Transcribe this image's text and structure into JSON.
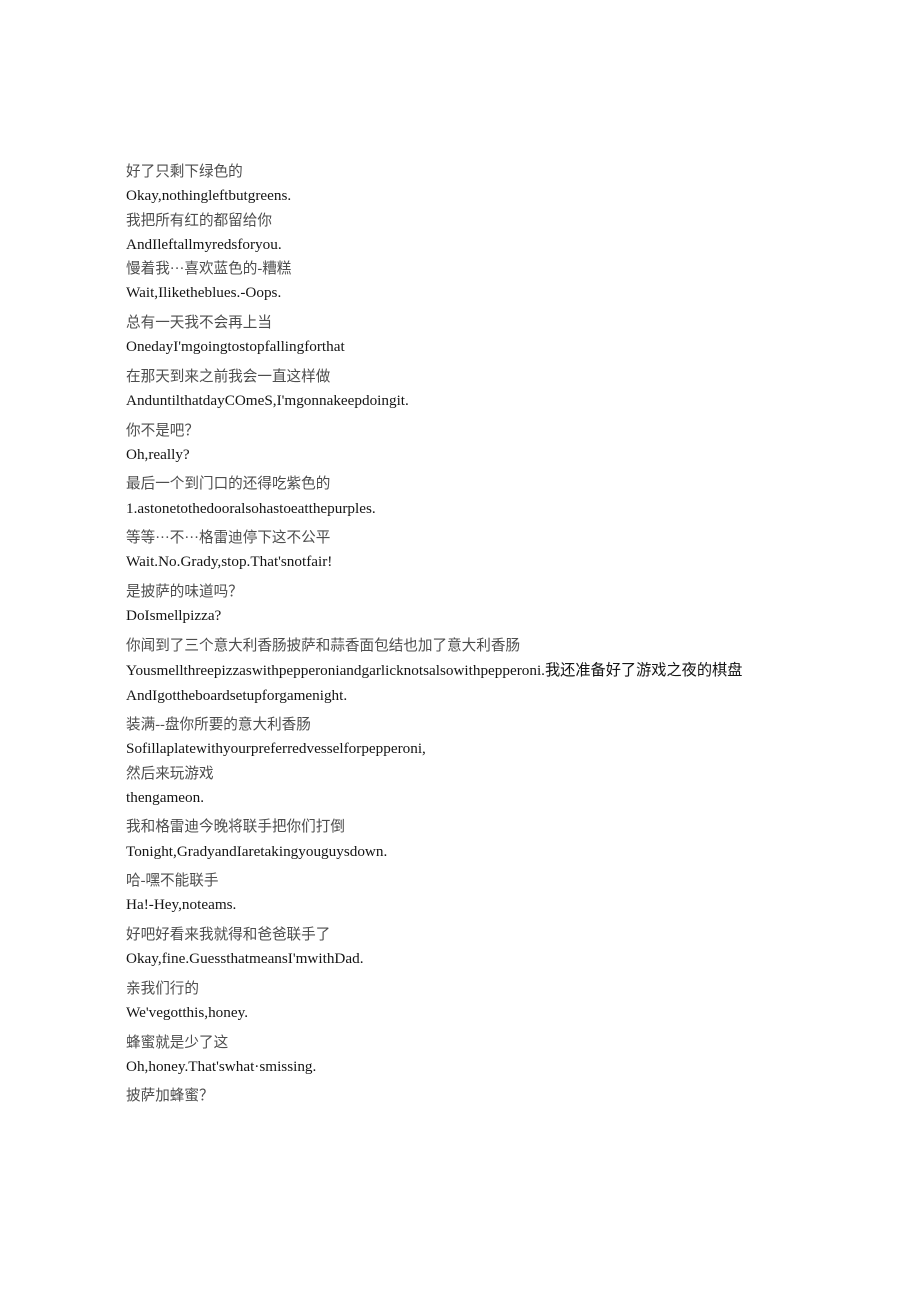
{
  "document": {
    "type": "bilingual-subtitle-transcript",
    "background_color": "#ffffff",
    "chinese_color": "#4d4d4d",
    "english_color": "#141414",
    "lines": [
      {
        "lang": "zh",
        "text": "好了只剩下绿色的",
        "spacing": "tight"
      },
      {
        "lang": "en",
        "text": "Okay,nothingleftbutgreens."
      },
      {
        "lang": "zh",
        "text": "我把所有红的都留给你",
        "spacing": "tight"
      },
      {
        "lang": "en",
        "text": "AndIleftallmyredsforyou."
      },
      {
        "lang": "zh",
        "text": "慢着我···喜欢蓝色的-糟糕",
        "spacing": "tight"
      },
      {
        "lang": "en",
        "text": "Wait,Iliketheblues.-Oops."
      },
      {
        "lang": "zh",
        "text": "总有一天我不会再上当",
        "spacing": "cue"
      },
      {
        "lang": "en",
        "text": "OnedayI'mgoingtostopfallingforthat"
      },
      {
        "lang": "zh",
        "text": "在那天到来之前我会一直这样做",
        "spacing": "cue"
      },
      {
        "lang": "en",
        "text": "AnduntilthatdayCOmeS,I'mgonnakeepdoingit."
      },
      {
        "lang": "zh",
        "text": "你不是吧？",
        "spacing": "cue"
      },
      {
        "lang": "en",
        "text": "Oh,really?"
      },
      {
        "lang": "zh",
        "text": "最后一个到门口的还得吃紫色的",
        "spacing": "cue"
      },
      {
        "lang": "en",
        "text": "1.astonetothedooralsohastoeatthepurples."
      },
      {
        "lang": "zh",
        "text": "等等···不···格雷迪停下这不公平",
        "spacing": "cue"
      },
      {
        "lang": "en",
        "text": "Wait.No.Grady,stop.That'snotfair!"
      },
      {
        "lang": "zh",
        "text": "是披萨的味道吗？",
        "spacing": "cue"
      },
      {
        "lang": "en",
        "text": "DoIsmellpizza?"
      },
      {
        "lang": "zh",
        "text": "你闻到了三个意大利香肠披萨和蒜香面包结也加了意大利香肠",
        "spacing": "cue"
      },
      {
        "lang": "en",
        "text": "Yousmellthreepizzaswithpepperoniandgarlicknotsalsowithpepperoni.我还准备好了游戏之夜的棋盘",
        "wrap": true
      },
      {
        "lang": "en",
        "text": "AndIgottheboardsetupforgamenight."
      },
      {
        "lang": "zh",
        "text": "装满--盘你所要的意大利香肠",
        "spacing": "cue"
      },
      {
        "lang": "en",
        "text": "Sofillaplatewithyourpreferredvesselforpepperoni,"
      },
      {
        "lang": "zh",
        "text": "然后来玩游戏",
        "spacing": "tight"
      },
      {
        "lang": "en",
        "text": "thengameon."
      },
      {
        "lang": "zh",
        "text": "我和格雷迪今晚将联手把你们打倒",
        "spacing": "cue"
      },
      {
        "lang": "en",
        "text": "Tonight,GradyandIaretakingyouguysdown."
      },
      {
        "lang": "zh",
        "text": "哈-嘿不能联手",
        "spacing": "cue"
      },
      {
        "lang": "en",
        "text": "Ha!-Hey,noteams."
      },
      {
        "lang": "zh",
        "text": "好吧好看来我就得和爸爸联手了",
        "spacing": "cue"
      },
      {
        "lang": "en",
        "text": "Okay,fine.GuessthatmeansI'mwithDad."
      },
      {
        "lang": "zh",
        "text": "亲我们行的",
        "spacing": "cue"
      },
      {
        "lang": "en",
        "text": "We'vegotthis,honey."
      },
      {
        "lang": "zh",
        "text": "蜂蜜就是少了这",
        "spacing": "cue"
      },
      {
        "lang": "en",
        "text": "Oh,honey.That'swhat·smissing."
      },
      {
        "lang": "zh",
        "text": "披萨加蜂蜜？",
        "spacing": "cue"
      }
    ]
  }
}
